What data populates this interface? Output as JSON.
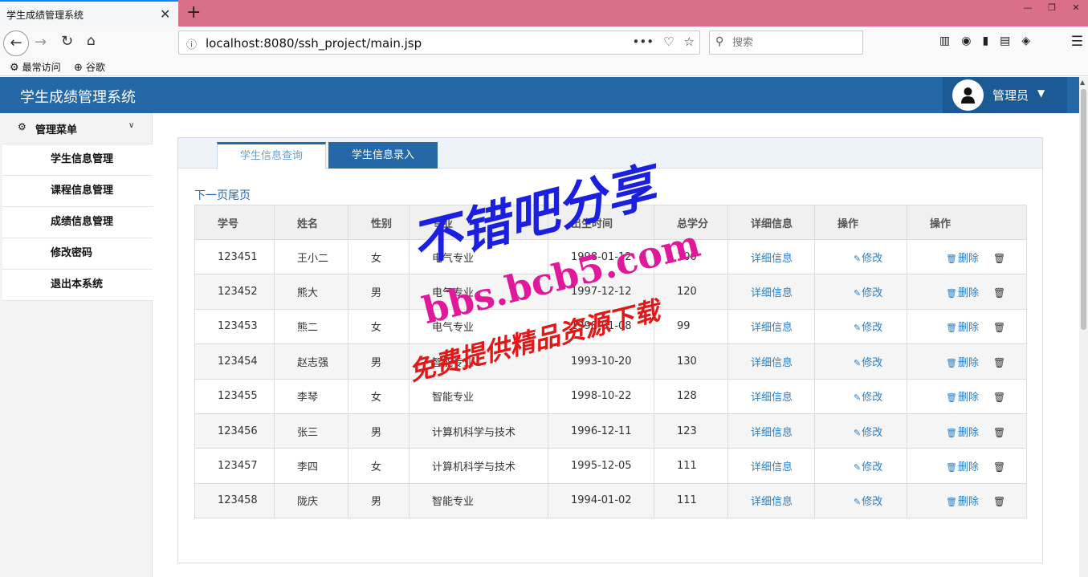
{
  "browser": {
    "tab_title": "学生成绩管理系统",
    "tab_close": "✕",
    "new_tab": "+",
    "url": "localhost:8080/ssh_project/main.jsp",
    "search_placeholder": "搜索",
    "bookmarks": [
      "最常访问",
      "谷歌"
    ]
  },
  "app": {
    "title": "学生成绩管理系统",
    "user": "管理员"
  },
  "sidebar": {
    "header": "管理菜单",
    "items": [
      "学生信息管理",
      "课程信息管理",
      "成绩信息管理",
      "修改密码",
      "退出本系统"
    ]
  },
  "tabs": {
    "query": "学生信息查询",
    "entry": "学生信息录入"
  },
  "pager": {
    "next": "下一页",
    "last": "尾页"
  },
  "table": {
    "headers": [
      "学号",
      "姓名",
      "性别",
      "专业",
      "出生时间",
      "总学分",
      "详细信息",
      "操作",
      "操作"
    ],
    "action_labels": {
      "detail": "详细信息",
      "edit": "修改",
      "delete": "删除"
    },
    "rows": [
      {
        "id": "123451",
        "name": "王小二",
        "gender": "女",
        "major": "电气专业",
        "birth": "1998-01-12",
        "credits": "100"
      },
      {
        "id": "123452",
        "name": "熊大",
        "gender": "男",
        "major": "电气专业",
        "birth": "1997-12-12",
        "credits": "120"
      },
      {
        "id": "123453",
        "name": "熊二",
        "gender": "女",
        "major": "电气专业",
        "birth": "1998-01-08",
        "credits": "99"
      },
      {
        "id": "123454",
        "name": "赵志强",
        "gender": "男",
        "major": "智能专业",
        "birth": "1993-10-20",
        "credits": "130"
      },
      {
        "id": "123455",
        "name": "李琴",
        "gender": "女",
        "major": "智能专业",
        "birth": "1998-10-22",
        "credits": "128"
      },
      {
        "id": "123456",
        "name": "张三",
        "gender": "男",
        "major": "计算机科学与技术",
        "birth": "1996-12-11",
        "credits": "123"
      },
      {
        "id": "123457",
        "name": "李四",
        "gender": "女",
        "major": "计算机科学与技术",
        "birth": "1995-12-05",
        "credits": "111"
      },
      {
        "id": "123458",
        "name": "陇庆",
        "gender": "男",
        "major": "智能专业",
        "birth": "1994-01-02",
        "credits": "111"
      }
    ]
  },
  "watermark": {
    "line1": "不错吧分享",
    "line2": "bbs.bcb5.com",
    "line3": "免费提供精品资源下载"
  },
  "colors": {
    "header_bg": "#2468a8",
    "link": "#2a7fc4",
    "tabbar": "#d97087"
  }
}
